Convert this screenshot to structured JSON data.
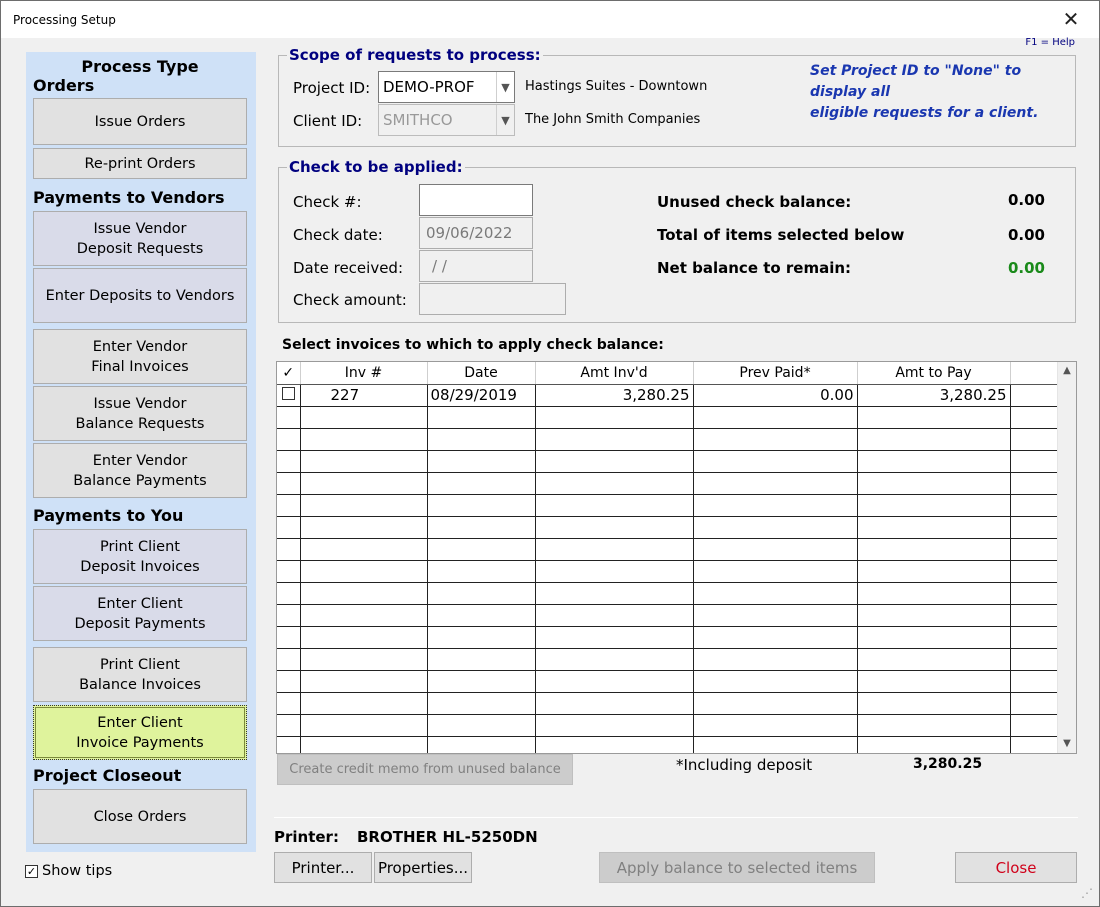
{
  "window": {
    "title": "Processing Setup",
    "help": "F1 = Help"
  },
  "left": {
    "process_type": "Process Type",
    "orders_heading": "Orders",
    "issue_orders": "Issue Orders",
    "reprint_orders": "Re-print Orders",
    "vendors_heading": "Payments to Vendors",
    "issue_vendor_deposit_1": "Issue Vendor",
    "issue_vendor_deposit_2": "Deposit Requests",
    "enter_deposits_vendors": "Enter Deposits to Vendors",
    "enter_vendor_final_1": "Enter Vendor",
    "enter_vendor_final_2": "Final Invoices",
    "issue_vendor_balance_1": "Issue Vendor",
    "issue_vendor_balance_2": "Balance Requests",
    "enter_vendor_balance_1": "Enter Vendor",
    "enter_vendor_balance_2": "Balance Payments",
    "you_heading": "Payments to You",
    "print_client_deposit_1": "Print Client",
    "print_client_deposit_2": "Deposit Invoices",
    "enter_client_deposit_1": "Enter Client",
    "enter_client_deposit_2": "Deposit Payments",
    "print_client_balance_1": "Print Client",
    "print_client_balance_2": "Balance Invoices",
    "enter_client_invoice_1": "Enter Client",
    "enter_client_invoice_2": "Invoice Payments",
    "closeout_heading": "Project Closeout",
    "close_orders": "Close Orders",
    "show_tips": "Show tips"
  },
  "scope": {
    "title": "Scope of requests to process:",
    "project_label": "Project ID:",
    "project_value": "DEMO-PROF",
    "project_desc": "Hastings Suites - Downtown",
    "client_label": "Client ID:",
    "client_value": "SMITHCO",
    "client_desc": "The John Smith Companies",
    "tip_line1": "Set Project ID to \"None\" to display all",
    "tip_line2": "eligible requests for a client."
  },
  "check": {
    "title": "Check to be applied:",
    "check_no_label": "Check #:",
    "check_no_value": "",
    "check_date_label": "Check date:",
    "check_date_value": "09/06/2022",
    "date_received_label": "Date received:",
    "date_received_value": " /  /",
    "amount_label": "Check amount:",
    "amount_value": "",
    "unused_label": "Unused check balance:",
    "unused_value": "0.00",
    "total_label": "Total of items selected  below",
    "total_value": "0.00",
    "net_label": "Net balance to remain:",
    "net_value": "0.00"
  },
  "grid": {
    "label": "Select invoices to which to apply check balance:",
    "headers": {
      "check": "✓",
      "inv": "Inv #",
      "date": "Date",
      "amt_invd": "Amt Inv'd",
      "prev_paid": "Prev Paid*",
      "amt_to_pay": "Amt to Pay"
    },
    "rows": [
      {
        "inv": "227",
        "date": "08/29/2019",
        "amt_invd": "3,280.25",
        "prev_paid": "0.00",
        "amt_to_pay": "3,280.25"
      }
    ],
    "including_label": "*Including deposit",
    "including_value": "3,280.25"
  },
  "buttons": {
    "credit_memo": "Create credit memo from unused balance",
    "printer": "Printer...",
    "properties": "Properties...",
    "apply": "Apply balance to selected items",
    "close": "Close"
  },
  "printer": {
    "label": "Printer:",
    "name": "BROTHER HL-5250DN"
  }
}
